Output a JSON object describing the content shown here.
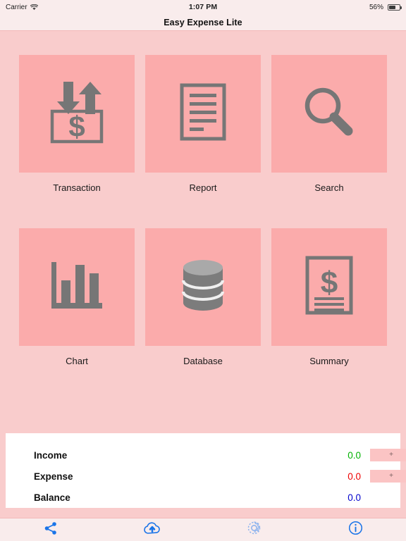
{
  "status_bar": {
    "carrier": "Carrier",
    "wifi_icon": "wifi-icon",
    "time": "1:07 PM",
    "battery_percent": "56%",
    "battery_icon": "battery-icon"
  },
  "navbar": {
    "title": "Easy Expense Lite"
  },
  "grid": {
    "tiles": [
      {
        "label": "Transaction",
        "icon": "transaction-box-arrows-dollar-icon"
      },
      {
        "label": "Report",
        "icon": "document-lines-icon"
      },
      {
        "label": "Search",
        "icon": "magnifier-icon"
      },
      {
        "label": "Chart",
        "icon": "bar-chart-icon"
      },
      {
        "label": "Database",
        "icon": "database-cylinder-icon"
      },
      {
        "label": "Summary",
        "icon": "document-dollar-icon"
      }
    ]
  },
  "summary": {
    "rows": [
      {
        "label": "Income",
        "value": "0.0",
        "color": "#00b200",
        "add_label": "+",
        "has_add": true
      },
      {
        "label": "Expense",
        "value": "0.0",
        "color": "#ee0000",
        "add_label": "+",
        "has_add": true
      },
      {
        "label": "Balance",
        "value": "0.0",
        "color": "#0000cc",
        "add_label": "",
        "has_add": false
      }
    ]
  },
  "toolbar": {
    "items": [
      {
        "name": "share-icon",
        "label": "Share"
      },
      {
        "name": "cloud-upload-icon",
        "label": "Backup"
      },
      {
        "name": "gear-icon",
        "label": "Settings"
      },
      {
        "name": "info-icon",
        "label": "About"
      }
    ]
  },
  "colors": {
    "background": "#f9cccc",
    "tile": "#fbabab",
    "bar": "#f9ecec",
    "icon_gray": "#767676",
    "accent_blue": "#1a74e8",
    "gear_blue": "#8fb4ee"
  }
}
